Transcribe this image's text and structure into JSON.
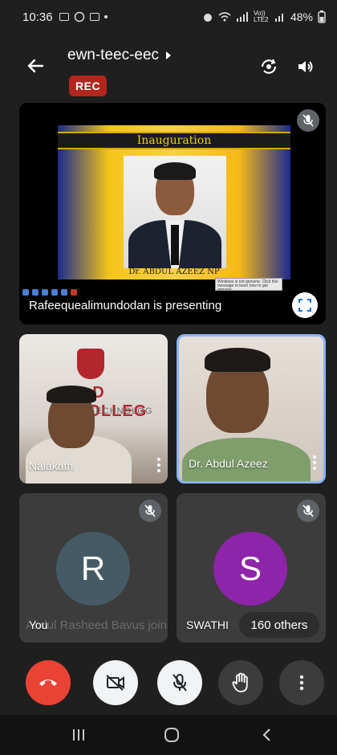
{
  "status_bar": {
    "time": "10:36",
    "network": "Vo)) LTE2",
    "battery": "48%"
  },
  "header": {
    "title": "ewn-teec-eec",
    "rec_label": "REC"
  },
  "presentation": {
    "slide_title": "Inauguration",
    "slide_caption": "Dr. ABDUL AZEEZ NP",
    "windows_note": "Windows is not genuine. Click this message to learn how to get genuine.",
    "presenter_label": "Rafeequealimundodan is presenting"
  },
  "participants": [
    {
      "name": "Nalakath",
      "banner": "A  D COLLEG",
      "banner_sub": "| TECHNOLOG"
    },
    {
      "name": "Dr. Abdul Azeez"
    },
    {
      "name": "You",
      "initial": "R",
      "ghost_text": "Abdul Rasheed Bavus joined"
    },
    {
      "name": "SWATHI",
      "initial": "S"
    }
  ],
  "others_label": "160 others",
  "colors": {
    "rec": "#b3261e",
    "hangup": "#ea4335",
    "avatar_r": "#455a64",
    "avatar_s": "#8e24aa",
    "active_border": "#8ab4f8"
  }
}
